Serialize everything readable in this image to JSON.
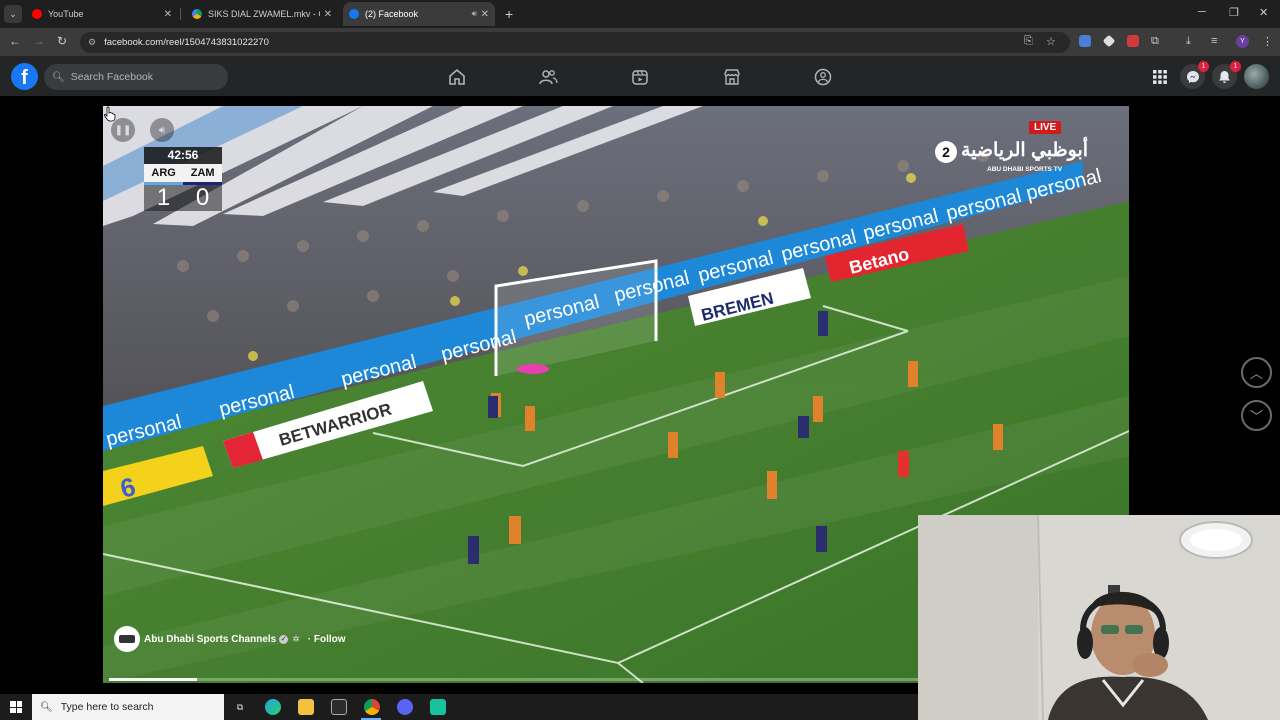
{
  "browser": {
    "tabs": [
      {
        "title": "YouTube",
        "favicon": "youtube-icon",
        "color": "#ff0000",
        "active": false
      },
      {
        "title": "SIKS DIAL ZWAMEL.mkv - Goog",
        "favicon": "google-drive-icon",
        "color": "#f4b400",
        "active": false
      },
      {
        "title": "(2) Facebook",
        "favicon": "facebook-icon",
        "color": "#1877f2",
        "active": true
      }
    ],
    "url": "facebook.com/reel/1504743831022270"
  },
  "facebook": {
    "search_placeholder": "Search Facebook",
    "nav_icons": [
      "home-icon",
      "friends-icon",
      "video-icon",
      "marketplace-icon",
      "groups-icon"
    ],
    "messenger_badge": "1",
    "notifications_badge": "1",
    "brand_color": "#1877f2"
  },
  "video": {
    "scoreboard": {
      "time": "42:56",
      "home_team": "ARG",
      "away_team": "ZAM",
      "home_score": "1",
      "away_score": "0"
    },
    "live_label": "LIVE",
    "channel": {
      "number": "2",
      "arabic_name": "أبوظبي الرياضية",
      "english_name": "ABU DHABI SPORTS TV"
    },
    "stadium_ads": {
      "personal": "personal",
      "bremen": "BREMEN",
      "betano": "Betano",
      "betwarrior": "BETWARRIOR"
    },
    "uploader_name": "Abu Dhabi Sports Channels",
    "follow_label": "· Follow",
    "progress_fraction": 0.087
  },
  "taskbar": {
    "search_placeholder": "Type here to search"
  }
}
